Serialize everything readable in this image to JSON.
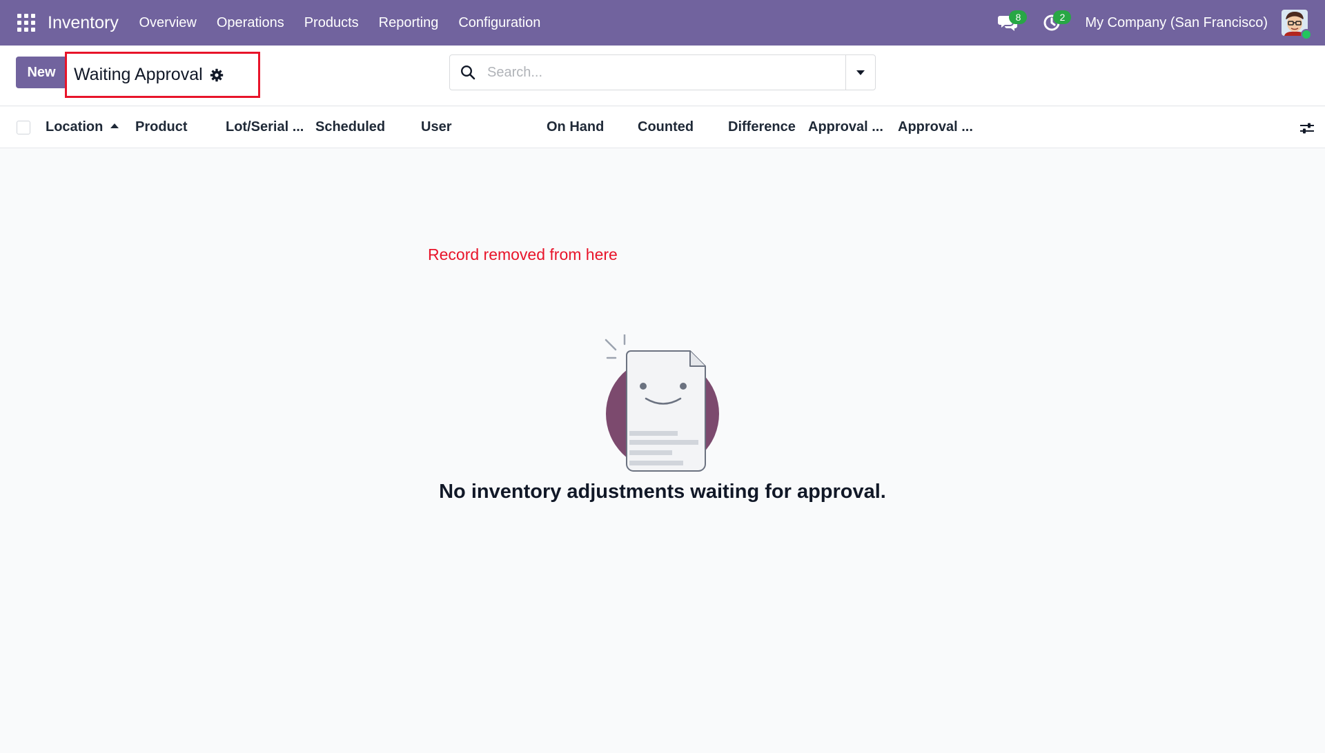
{
  "navbar": {
    "app_name": "Inventory",
    "menu": [
      "Overview",
      "Operations",
      "Products",
      "Reporting",
      "Configuration"
    ],
    "messages_count": "8",
    "activities_count": "2",
    "company": "My Company (San Francisco)"
  },
  "control_panel": {
    "new_label": "New",
    "title": "Waiting Approval",
    "search_placeholder": "Search..."
  },
  "list": {
    "columns": [
      "Location",
      "Product",
      "Lot/Serial ...",
      "Scheduled",
      "User",
      "On Hand",
      "Counted",
      "Difference",
      "Approval ...",
      "Approval ..."
    ],
    "sorted_column": "Location",
    "sort_direction": "ascending"
  },
  "annotation": {
    "note": "Record removed from here",
    "highlight_color": "#e8142a"
  },
  "empty_state": {
    "title": "No inventory adjustments waiting for approval."
  },
  "colors": {
    "brand": "#71639e",
    "badge": "#28a745",
    "background": "#f9fafb"
  }
}
